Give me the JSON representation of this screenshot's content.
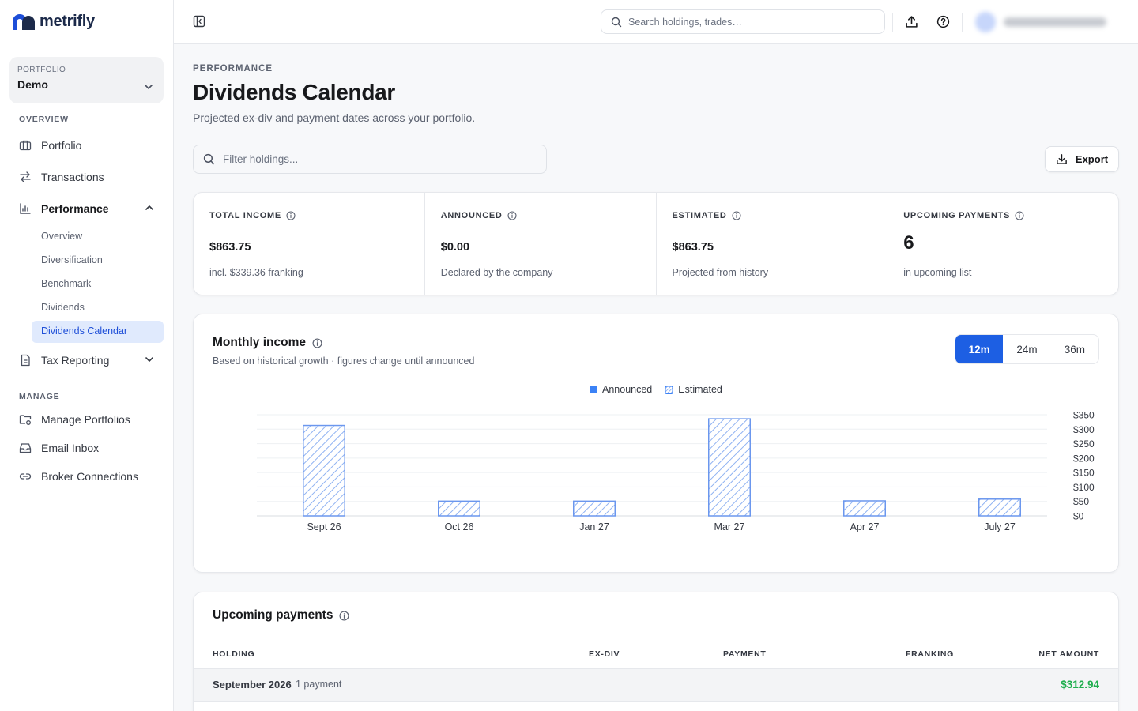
{
  "app": {
    "name": "metrifly"
  },
  "sidebar": {
    "portfolio_label": "PORTFOLIO",
    "portfolio_value": "Demo",
    "overview_label": "OVERVIEW",
    "manage_label": "MANAGE",
    "items": {
      "portfolio": "Portfolio",
      "transactions": "Transactions",
      "performance": "Performance",
      "tax": "Tax Reporting",
      "manage_portfolios": "Manage Portfolios",
      "email_inbox": "Email Inbox",
      "broker_connections": "Broker Connections"
    },
    "sub_items": {
      "overview": "Overview",
      "diversification": "Diversification",
      "benchmark": "Benchmark",
      "dividends": "Dividends",
      "dividends_calendar": "Dividends Calendar"
    }
  },
  "header": {
    "search_placeholder": "Search holdings, trades…"
  },
  "page": {
    "breadcrumb": "PERFORMANCE",
    "title": "Dividends Calendar",
    "subtitle": "Projected ex-div and payment dates across your portfolio.",
    "filter_placeholder": "Filter holdings...",
    "export_label": "Export"
  },
  "stats": [
    {
      "label": "TOTAL INCOME",
      "value": "$863.75",
      "foot": "incl. $339.36 franking"
    },
    {
      "label": "ANNOUNCED",
      "value": "$0.00",
      "foot": "Declared by the company"
    },
    {
      "label": "ESTIMATED",
      "value": "$863.75",
      "foot": "Projected from history"
    },
    {
      "label": "UPCOMING PAYMENTS",
      "value": "6",
      "foot": "in upcoming list"
    }
  ],
  "monthly": {
    "title": "Monthly income",
    "subtitle": "Based on historical growth · figures change until announced",
    "ranges": [
      "12m",
      "24m",
      "36m"
    ],
    "selected_range": "12m",
    "legend": {
      "announced": "Announced",
      "estimated": "Estimated"
    },
    "colors": {
      "announced": "#3b82f6",
      "estimated": "#93b4f3",
      "estimated_stroke": "#6b97ee"
    }
  },
  "chart_data": {
    "type": "bar",
    "categories": [
      "Sept 26",
      "Oct 26",
      "Jan 27",
      "Mar 27",
      "Apr 27",
      "July 27"
    ],
    "series": [
      {
        "name": "Announced",
        "values": [
          0,
          0,
          0,
          0,
          0,
          0
        ]
      },
      {
        "name": "Estimated",
        "values": [
          312.94,
          51,
          51,
          336,
          52,
          58
        ]
      }
    ],
    "ylim": [
      0,
      350
    ],
    "yticks": [
      "$0",
      "$50",
      "$100",
      "$150",
      "$200",
      "$250",
      "$300",
      "$350"
    ],
    "ytick_values": [
      0,
      50,
      100,
      150,
      200,
      250,
      300,
      350
    ],
    "grid": true,
    "legend_position": "top-center"
  },
  "payments": {
    "title": "Upcoming payments",
    "columns": {
      "holding": "HOLDING",
      "exdiv": "EX-DIV",
      "payment": "PAYMENT",
      "franking": "FRANKING",
      "net": "NET AMOUNT"
    },
    "groups": [
      {
        "month": "September 2026",
        "count": "1 payment",
        "amount": "$312.94"
      }
    ]
  }
}
